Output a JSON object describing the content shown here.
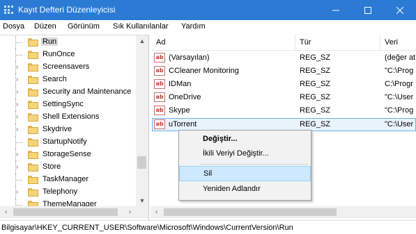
{
  "window": {
    "title": "Kayıt Defteri Düzenleyicisi",
    "title_bar_color": "#2b7bd4",
    "controls": [
      "minimize",
      "maximize",
      "close"
    ]
  },
  "menu": [
    "Dosya",
    "Düzen",
    "Görünüm",
    "Sık Kullanılanlar",
    "Yardım"
  ],
  "tree": {
    "items": [
      {
        "label": "Run",
        "expandable": false,
        "selected": true
      },
      {
        "label": "RunOnce",
        "expandable": false
      },
      {
        "label": "Screensavers",
        "expandable": true
      },
      {
        "label": "Search",
        "expandable": true
      },
      {
        "label": "Security and Maintenance",
        "expandable": true
      },
      {
        "label": "SettingSync",
        "expandable": true
      },
      {
        "label": "Shell Extensions",
        "expandable": true
      },
      {
        "label": "Skydrive",
        "expandable": true
      },
      {
        "label": "StartupNotify",
        "expandable": false
      },
      {
        "label": "StorageSense",
        "expandable": true
      },
      {
        "label": "Store",
        "expandable": true
      },
      {
        "label": "TaskManager",
        "expandable": false
      },
      {
        "label": "Telephony",
        "expandable": true
      },
      {
        "label": "ThemeManager",
        "expandable": false
      }
    ]
  },
  "list": {
    "columns": {
      "name": "Ad",
      "type": "Tür",
      "data": "Veri"
    },
    "rows": [
      {
        "name": "(Varsayılan)",
        "type": "REG_SZ",
        "data": "(değer at"
      },
      {
        "name": "CCleaner Monitoring",
        "type": "REG_SZ",
        "data": "\"C:\\Prog"
      },
      {
        "name": "IDMan",
        "type": "REG_SZ",
        "data": "C:\\Progr"
      },
      {
        "name": "OneDrive",
        "type": "REG_SZ",
        "data": "\"C:\\User"
      },
      {
        "name": "Skype",
        "type": "REG_SZ",
        "data": "\"C:\\Prog"
      },
      {
        "name": "uTorrent",
        "type": "REG_SZ",
        "data": "\"C:\\User",
        "selected": true
      }
    ],
    "value_icon_text": "ab"
  },
  "context_menu": {
    "items": [
      {
        "label": "Değiştir...",
        "bold": true
      },
      {
        "label": "İkili Veriyi Değiştir..."
      },
      {
        "label": "Sil",
        "highlighted": true
      },
      {
        "label": "Yeniden Adlandır"
      }
    ],
    "highlight_color": "#cde8ff"
  },
  "status": {
    "path": "Bilgisayar\\HKEY_CURRENT_USER\\Software\\Microsoft\\Windows\\CurrentVersion\\Run"
  }
}
